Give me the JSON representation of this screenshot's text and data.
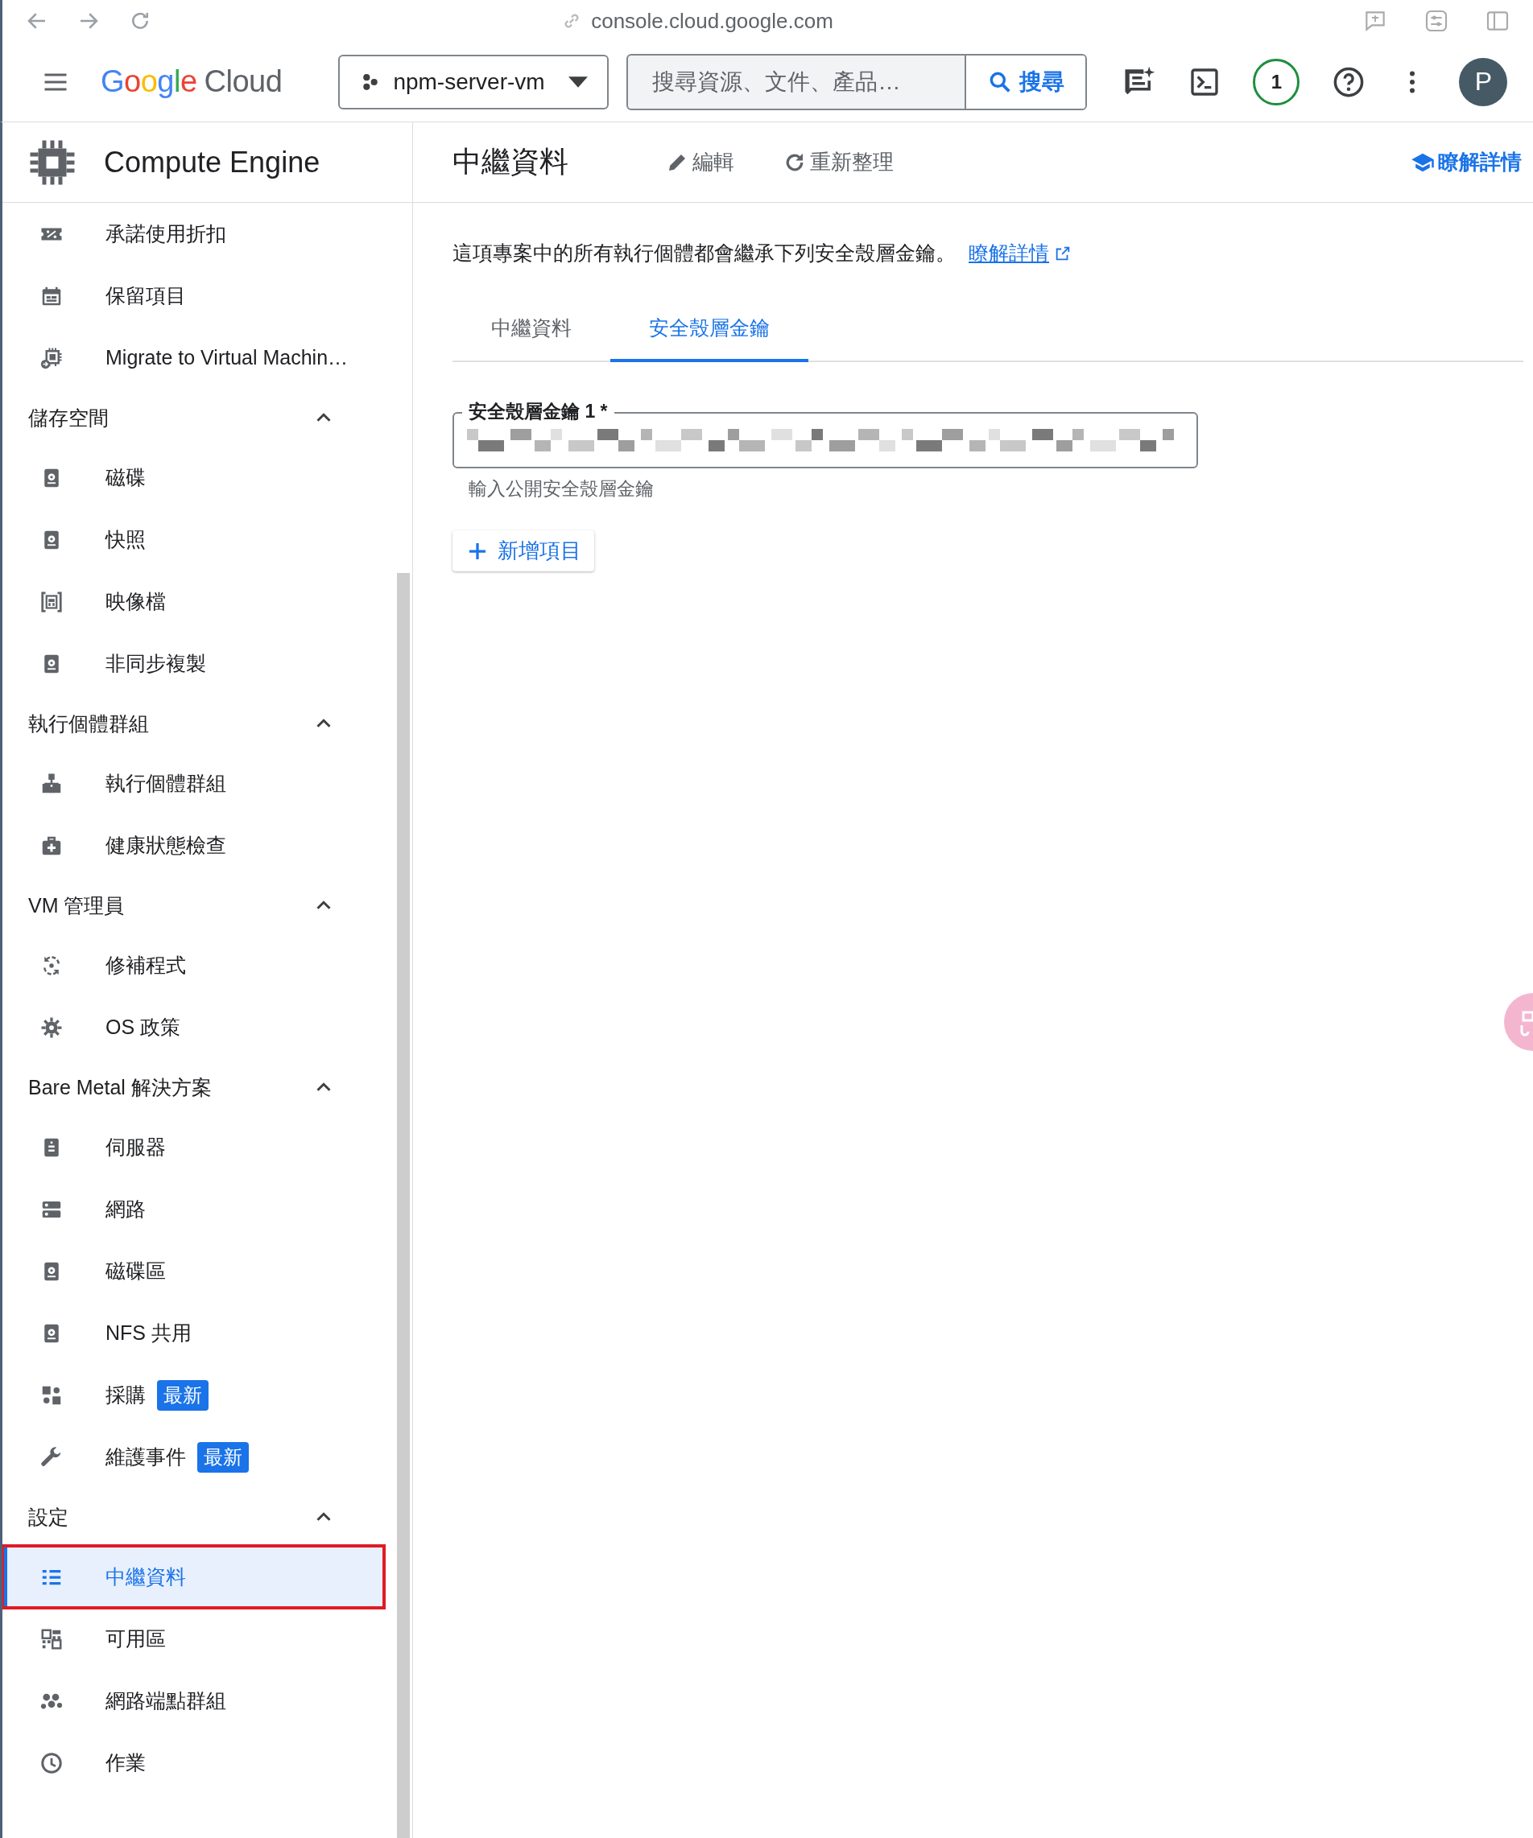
{
  "browser": {
    "url": "console.cloud.google.com"
  },
  "header": {
    "logo": [
      "Google",
      "Cloud"
    ],
    "project": "npm-server-vm",
    "search": {
      "placeholder": "搜尋資源、文件、產品…",
      "button": "搜尋"
    },
    "notifications": "1",
    "avatar": "P"
  },
  "sidebar": {
    "title": "Compute Engine",
    "entries": [
      {
        "kind": "item",
        "label": "承諾使用折扣",
        "selected": false
      },
      {
        "kind": "item",
        "label": "保留項目",
        "selected": false
      },
      {
        "kind": "item",
        "label": "Migrate to Virtual Machin…",
        "selected": false
      },
      {
        "kind": "section",
        "label": "儲存空間",
        "expanded": true,
        "children": [
          {
            "kind": "item",
            "label": "磁碟",
            "selected": false
          },
          {
            "kind": "item",
            "label": "快照",
            "selected": false
          },
          {
            "kind": "item",
            "label": "映像檔",
            "selected": false
          },
          {
            "kind": "item",
            "label": "非同步複製",
            "selected": false
          }
        ]
      },
      {
        "kind": "section",
        "label": "執行個體群組",
        "expanded": true,
        "children": [
          {
            "kind": "item",
            "label": "執行個體群組",
            "selected": false
          },
          {
            "kind": "item",
            "label": "健康狀態檢查",
            "selected": false
          }
        ]
      },
      {
        "kind": "section",
        "label": "VM 管理員",
        "expanded": true,
        "children": [
          {
            "kind": "item",
            "label": "修補程式",
            "selected": false
          },
          {
            "kind": "item",
            "label": "OS 政策",
            "selected": false
          }
        ]
      },
      {
        "kind": "section",
        "label": "Bare Metal 解決方案",
        "expanded": true,
        "children": [
          {
            "kind": "item",
            "label": "伺服器",
            "selected": false
          },
          {
            "kind": "item",
            "label": "網路",
            "selected": false
          },
          {
            "kind": "item",
            "label": "磁碟區",
            "selected": false
          },
          {
            "kind": "item",
            "label": "NFS 共用",
            "selected": false
          },
          {
            "kind": "item",
            "label": "採購",
            "selected": false,
            "badge": "最新"
          },
          {
            "kind": "item",
            "label": "維護事件",
            "selected": false,
            "badge": "最新"
          }
        ]
      },
      {
        "kind": "section",
        "label": "設定",
        "expanded": true,
        "children": [
          {
            "kind": "item",
            "label": "中繼資料",
            "selected": true,
            "annotated": true
          },
          {
            "kind": "item",
            "label": "可用區",
            "selected": false
          },
          {
            "kind": "item",
            "label": "網路端點群組",
            "selected": false
          },
          {
            "kind": "item",
            "label": "作業",
            "selected": false
          }
        ]
      }
    ]
  },
  "main": {
    "title": "中繼資料",
    "actions": [
      "編輯",
      "重新整理"
    ],
    "learn_more": "瞭解詳情",
    "description": "這項專案中的所有執行個體都會繼承下列安全殼層金鑰。",
    "description_link": "瞭解詳情",
    "tabs": [
      {
        "label": "中繼資料",
        "selected": false
      },
      {
        "label": "安全殼層金鑰",
        "selected": true
      }
    ],
    "key_field": {
      "label": "安全殼層金鑰 1 *",
      "redacted": true,
      "helper": "輸入公開安全殼層金鑰"
    },
    "add_button": "新增項目"
  }
}
